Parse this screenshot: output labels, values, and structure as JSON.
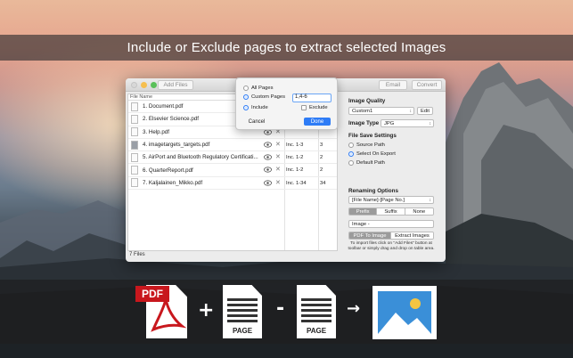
{
  "banner": {
    "title": "Include or Exclude pages to extract selected Images"
  },
  "window": {
    "toolbar": {
      "add_files": "Add Files",
      "email": "Email",
      "convert": "Convert"
    },
    "table": {
      "header": "File Name",
      "rows": [
        {
          "name": "1. Document.pdf",
          "range": "",
          "pages": "",
          "thumb": "doc"
        },
        {
          "name": "2. Elsevier Science.pdf",
          "range": "",
          "pages": "",
          "thumb": "doc"
        },
        {
          "name": "3. Help.pdf",
          "range": "",
          "pages": "",
          "thumb": "doc"
        },
        {
          "name": "4. imagetargets_targets.pdf",
          "range": "Inc. 1-3",
          "pages": "3",
          "thumb": "img"
        },
        {
          "name": "5. AirPort and Bluetooth Regulatory Certificati...",
          "range": "Inc. 1-2",
          "pages": "2",
          "thumb": "doc"
        },
        {
          "name": "6. QuarterReport.pdf",
          "range": "Inc. 1-2",
          "pages": "2",
          "thumb": "doc"
        },
        {
          "name": "7. Kaljalainen_Mikko.pdf",
          "range": "Inc. 1-34",
          "pages": "34",
          "thumb": "doc"
        }
      ],
      "footer": "7 Files"
    },
    "panel": {
      "image_quality_title": "Image Quality",
      "quality_value": "Custom1",
      "edit": "Edit",
      "image_type_label": "Image Type",
      "image_type_value": "JPG",
      "file_save_title": "File Save Settings",
      "save_options": [
        "Source Path",
        "Select On Export",
        "Default Path"
      ],
      "save_selected": 1,
      "renaming_title": "Renaming Options",
      "rename_value": "[File Name]-[Page No.]",
      "affix": [
        "Prefix",
        "Suffix",
        "None"
      ],
      "affix_selected": 0,
      "affix_text": "Image -",
      "mode_tabs": [
        "PDF To Image",
        "Extract Images"
      ],
      "hint": "To import files click on \"Add Files\" button at toolbar or simply drag and drop on table area."
    }
  },
  "popover": {
    "all_pages": "All Pages",
    "custom_pages": "Custom Pages",
    "custom_value": "1,4-6",
    "include": "Include",
    "exclude": "Exclude",
    "cancel": "Cancel",
    "done": "Done"
  },
  "bottom": {
    "pdf_label": "PDF",
    "page_label": "PAGE",
    "plus": "+",
    "minus": "-",
    "arrow": "→"
  },
  "colors": {
    "accent": "#2e7cf6",
    "pdf_red": "#c8171d"
  }
}
